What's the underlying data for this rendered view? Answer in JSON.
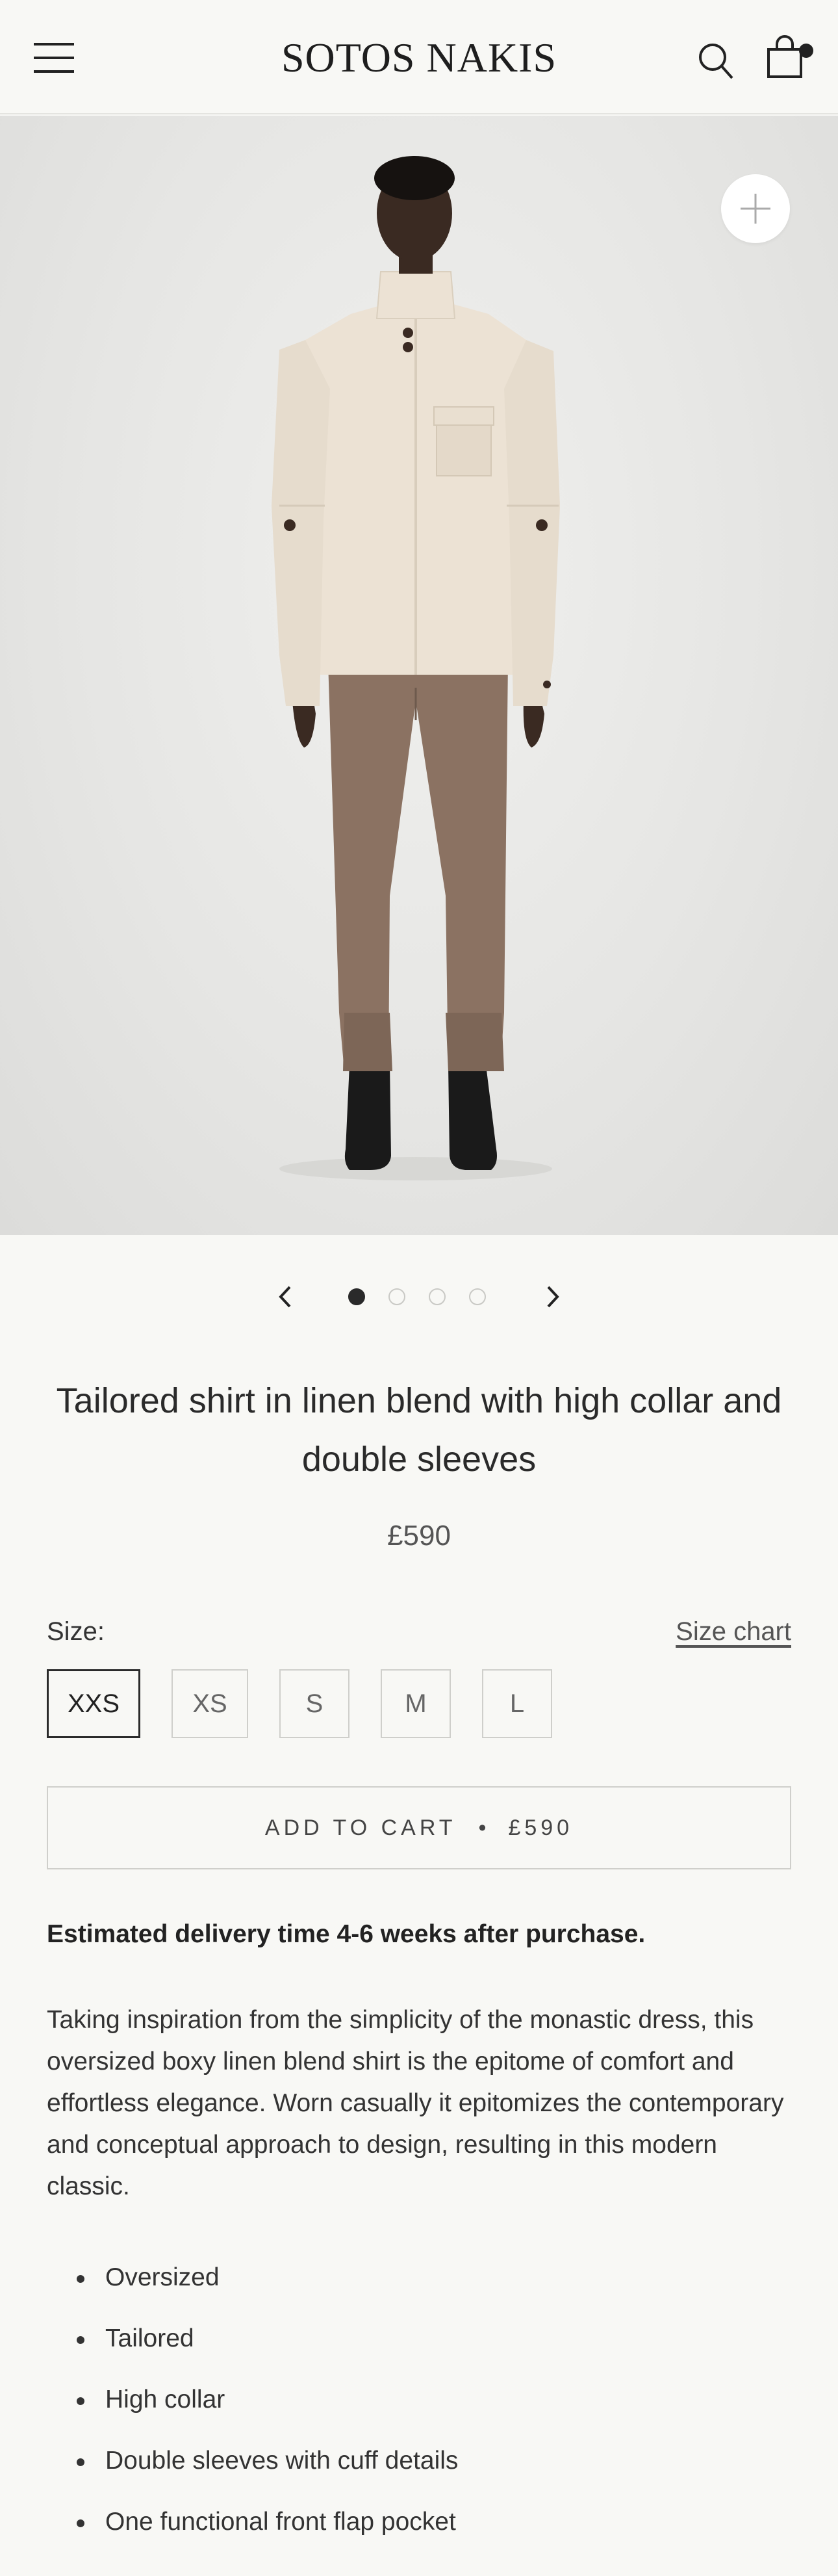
{
  "header": {
    "logo": "SOTOS NAKIS",
    "menu_icon": "hamburger-menu-icon",
    "search_icon": "search-icon",
    "cart_icon": "shopping-bag-icon"
  },
  "gallery": {
    "zoom_icon": "plus-icon",
    "prev_icon": "chevron-left-icon",
    "next_icon": "chevron-right-icon",
    "slide_count": 4,
    "active_slide": 1
  },
  "product": {
    "title": "Tailored shirt in linen blend with high collar and double sleeves",
    "price": "£590",
    "size_label": "Size:",
    "size_chart_label": "Size chart",
    "sizes": [
      "XXS",
      "XS",
      "S",
      "M",
      "L"
    ],
    "selected_size": "XXS",
    "add_to_cart_label": "ADD TO CART",
    "add_to_cart_separator": "•",
    "add_to_cart_price": "£590",
    "delivery": "Estimated delivery time 4-6 weeks after purchase.",
    "description": "Taking inspiration from the simplicity of the monastic dress, this oversized boxy linen blend shirt is the epitome of comfort and effortless elegance. Worn casually it epitomizes the contemporary and conceptual approach to design, resulting in this modern classic.",
    "features": [
      "Oversized",
      "Tailored",
      "High collar",
      "Double sleeves with cuff details",
      "One functional front flap pocket"
    ]
  },
  "colors": {
    "background": "#f8f8f5",
    "text": "#222222",
    "border": "#cfcfcb",
    "shirt": "#ece2d4",
    "trousers": "#8b7262"
  }
}
